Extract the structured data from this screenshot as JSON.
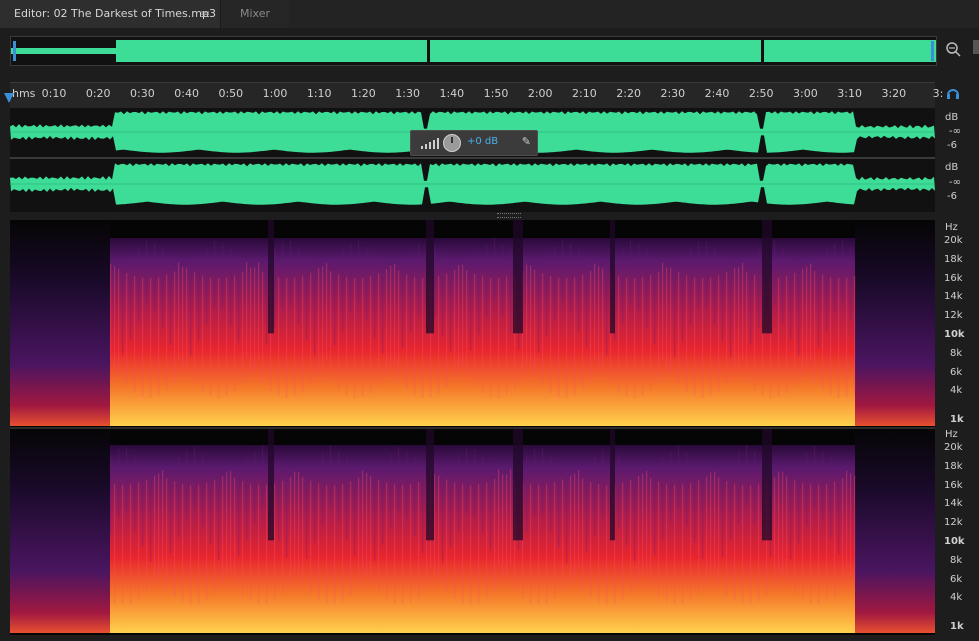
{
  "tabs": {
    "editor_label": "Editor: 02 The Darkest of Times.mp3",
    "editor_menu_icon": "≡",
    "mixer_label": "Mixer"
  },
  "ruler": {
    "unit": "hms",
    "ticks": [
      "0:10",
      "0:20",
      "0:30",
      "0:40",
      "0:50",
      "1:00",
      "1:10",
      "1:20",
      "1:30",
      "1:40",
      "1:50",
      "2:00",
      "2:10",
      "2:20",
      "2:30",
      "2:40",
      "2:50",
      "3:00",
      "3:10",
      "3:20",
      "3:"
    ]
  },
  "hud": {
    "gain": "+0 dB",
    "icons": [
      "level-meter-icon",
      "gain-knob-icon",
      "pin-icon"
    ]
  },
  "waveform": {
    "unit": "dB",
    "labels": [
      "-∞",
      "-6"
    ],
    "color": "#3ddc97"
  },
  "spectral": {
    "unit": "Hz",
    "labels": [
      "20k",
      "18k",
      "16k",
      "14k",
      "12k",
      "10k",
      "8k",
      "6k",
      "4k",
      "1k"
    ],
    "bold_labels": [
      "10k",
      "1k"
    ]
  },
  "colors": {
    "waveform": "#3ddc97",
    "playhead": "#3b8fd6",
    "accent_text": "#4ab0e8",
    "spectral_low": "#ffd24d",
    "spectral_mid": "#e8262d",
    "spectral_high": "#5a1a6e"
  }
}
